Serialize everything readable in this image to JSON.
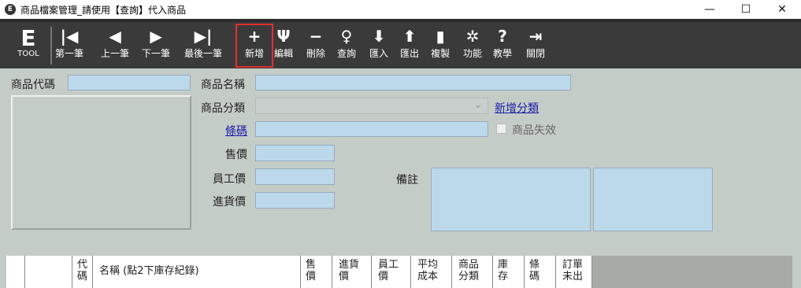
{
  "window": {
    "title": "商品檔案管理_請使用【查詢】代入商品",
    "app_icon": "E",
    "min": "—",
    "max": "☐",
    "close": "✕"
  },
  "logo": {
    "big": "E",
    "small": "TOOL"
  },
  "toolbar": [
    {
      "id": "first",
      "label": "第一筆",
      "icon": "first-icon",
      "glyph": "|◀"
    },
    {
      "id": "prev",
      "label": "上一筆",
      "icon": "arrow-left-icon",
      "glyph": "◀"
    },
    {
      "id": "next",
      "label": "下一筆",
      "icon": "arrow-right-icon",
      "glyph": "▶"
    },
    {
      "id": "last",
      "label": "最後一筆",
      "icon": "last-icon",
      "glyph": "▶|"
    },
    {
      "id": "add",
      "label": "新增",
      "icon": "plus-icon",
      "glyph": "+"
    },
    {
      "id": "edit",
      "label": "編輯",
      "icon": "edit-icon",
      "glyph": "Ψ"
    },
    {
      "id": "delete",
      "label": "刪除",
      "icon": "minus-icon",
      "glyph": "−"
    },
    {
      "id": "query",
      "label": "查詢",
      "icon": "search-icon",
      "glyph": "♀"
    },
    {
      "id": "import",
      "label": "匯入",
      "icon": "arrow-down-icon",
      "glyph": "⬇"
    },
    {
      "id": "export",
      "label": "匯出",
      "icon": "arrow-up-icon",
      "glyph": "⬆"
    },
    {
      "id": "copy",
      "label": "複製",
      "icon": "copy-icon",
      "glyph": "▮"
    },
    {
      "id": "func",
      "label": "功能",
      "icon": "function-icon",
      "glyph": "✲"
    },
    {
      "id": "teach",
      "label": "教學",
      "icon": "help-icon",
      "glyph": "?"
    },
    {
      "id": "close",
      "label": "關閉",
      "icon": "exit-icon",
      "glyph": "⇥"
    }
  ],
  "form": {
    "product_code_label": "商品代碼",
    "product_name_label": "商品名稱",
    "category_label": "商品分類",
    "add_category_link": "新增分類",
    "barcode_link": "條碼",
    "inactive_label": "商品失效",
    "price_label": "售價",
    "employee_price_label": "員工價",
    "purchase_price_label": "進貨價",
    "note_label": "備註",
    "dropdown_chevron": "⌄"
  },
  "grid": {
    "columns": [
      "",
      "",
      "代\n碼",
      "名稱 (點2下庫存紀錄)",
      "售\n價",
      "進貨\n價",
      "員工\n價",
      "平均\n成本",
      "商品\n分類",
      "庫\n存",
      "條\n碼",
      "訂單\n未出"
    ]
  }
}
